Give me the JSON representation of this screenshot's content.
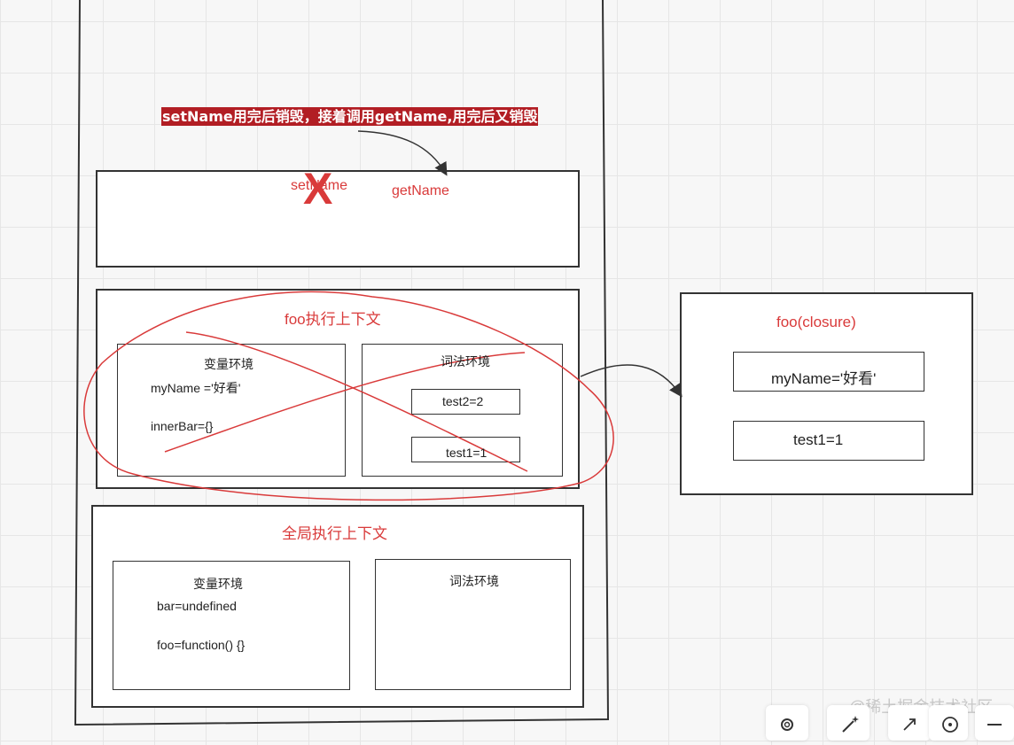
{
  "annotation": {
    "banner": "setName用完后销毁，接着调用getName,用完后又销毁"
  },
  "stack": {
    "top_frame": {
      "destroyed_label": "setName",
      "active_label": "getName",
      "cross_mark": "X"
    },
    "foo_context": {
      "title": "foo执行上下文",
      "variable_env": {
        "title": "变量环境",
        "entries": [
          "myName ='好看'",
          "innerBar={}"
        ]
      },
      "lexical_env": {
        "title": "词法环境",
        "entries": [
          "test2=2",
          "test1=1"
        ]
      }
    },
    "global_context": {
      "title": "全局执行上下文",
      "variable_env": {
        "title": "变量环境",
        "entries": [
          "bar=undefined",
          "foo=function()  {}"
        ]
      },
      "lexical_env": {
        "title": "词法环境"
      }
    }
  },
  "closure": {
    "title": "foo(closure)",
    "entries": [
      "myName='好看'",
      "test1=1"
    ]
  },
  "watermark": "@稀土掘金技术社区",
  "toolbar": {
    "icons": [
      "gear-icon",
      "magic-wand-icon",
      "expand-icon",
      "target-icon",
      "minus-icon"
    ]
  },
  "colors": {
    "accent_red": "#d93a3a",
    "banner_bg": "#b21e24",
    "stroke": "#333333"
  }
}
